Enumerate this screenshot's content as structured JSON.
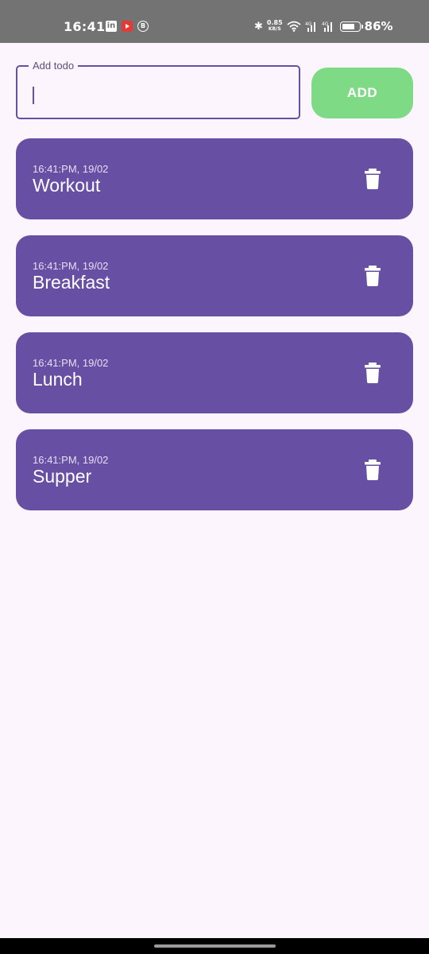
{
  "status_bar": {
    "time": "16:41",
    "notification_icons": [
      "linkedin-icon",
      "youtube-icon",
      "b-circle-icon"
    ],
    "net_speed_value": "0.85",
    "net_speed_unit": "KB/S",
    "signal_label_1": "4G",
    "signal_label_2": "4G",
    "battery_level": 0.86,
    "battery_percent": "86%"
  },
  "input": {
    "label": "Add todo",
    "value": "",
    "add_button_label": "ADD"
  },
  "todos": [
    {
      "time": "16:41:PM, 19/02",
      "title": "Workout"
    },
    {
      "time": "16:41:PM, 19/02",
      "title": "Breakfast"
    },
    {
      "time": "16:41:PM, 19/02",
      "title": "Lunch"
    },
    {
      "time": "16:41:PM, 19/02",
      "title": "Supper"
    }
  ],
  "colors": {
    "background": "#fcf5fd",
    "accent": "#6750a4",
    "add_button": "#7fda85",
    "status_bar": "#737373"
  }
}
